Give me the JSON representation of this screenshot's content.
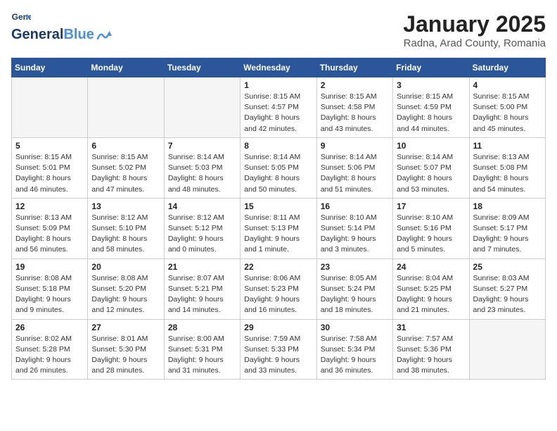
{
  "logo": {
    "text_general": "General",
    "text_blue": "Blue",
    "icon_color": "#4a90d9"
  },
  "header": {
    "month": "January 2025",
    "location": "Radna, Arad County, Romania"
  },
  "weekdays": [
    "Sunday",
    "Monday",
    "Tuesday",
    "Wednesday",
    "Thursday",
    "Friday",
    "Saturday"
  ],
  "weeks": [
    [
      {
        "day": "",
        "empty": true
      },
      {
        "day": "",
        "empty": true
      },
      {
        "day": "",
        "empty": true
      },
      {
        "day": "1",
        "sunrise": "8:15 AM",
        "sunset": "4:57 PM",
        "daylight": "8 hours and 42 minutes."
      },
      {
        "day": "2",
        "sunrise": "8:15 AM",
        "sunset": "4:58 PM",
        "daylight": "8 hours and 43 minutes."
      },
      {
        "day": "3",
        "sunrise": "8:15 AM",
        "sunset": "4:59 PM",
        "daylight": "8 hours and 44 minutes."
      },
      {
        "day": "4",
        "sunrise": "8:15 AM",
        "sunset": "5:00 PM",
        "daylight": "8 hours and 45 minutes."
      }
    ],
    [
      {
        "day": "5",
        "sunrise": "8:15 AM",
        "sunset": "5:01 PM",
        "daylight": "8 hours and 46 minutes."
      },
      {
        "day": "6",
        "sunrise": "8:15 AM",
        "sunset": "5:02 PM",
        "daylight": "8 hours and 47 minutes."
      },
      {
        "day": "7",
        "sunrise": "8:14 AM",
        "sunset": "5:03 PM",
        "daylight": "8 hours and 48 minutes."
      },
      {
        "day": "8",
        "sunrise": "8:14 AM",
        "sunset": "5:05 PM",
        "daylight": "8 hours and 50 minutes."
      },
      {
        "day": "9",
        "sunrise": "8:14 AM",
        "sunset": "5:06 PM",
        "daylight": "8 hours and 51 minutes."
      },
      {
        "day": "10",
        "sunrise": "8:14 AM",
        "sunset": "5:07 PM",
        "daylight": "8 hours and 53 minutes."
      },
      {
        "day": "11",
        "sunrise": "8:13 AM",
        "sunset": "5:08 PM",
        "daylight": "8 hours and 54 minutes."
      }
    ],
    [
      {
        "day": "12",
        "sunrise": "8:13 AM",
        "sunset": "5:09 PM",
        "daylight": "8 hours and 56 minutes."
      },
      {
        "day": "13",
        "sunrise": "8:12 AM",
        "sunset": "5:10 PM",
        "daylight": "8 hours and 58 minutes."
      },
      {
        "day": "14",
        "sunrise": "8:12 AM",
        "sunset": "5:12 PM",
        "daylight": "9 hours and 0 minutes."
      },
      {
        "day": "15",
        "sunrise": "8:11 AM",
        "sunset": "5:13 PM",
        "daylight": "9 hours and 1 minute."
      },
      {
        "day": "16",
        "sunrise": "8:10 AM",
        "sunset": "5:14 PM",
        "daylight": "9 hours and 3 minutes."
      },
      {
        "day": "17",
        "sunrise": "8:10 AM",
        "sunset": "5:16 PM",
        "daylight": "9 hours and 5 minutes."
      },
      {
        "day": "18",
        "sunrise": "8:09 AM",
        "sunset": "5:17 PM",
        "daylight": "9 hours and 7 minutes."
      }
    ],
    [
      {
        "day": "19",
        "sunrise": "8:08 AM",
        "sunset": "5:18 PM",
        "daylight": "9 hours and 9 minutes."
      },
      {
        "day": "20",
        "sunrise": "8:08 AM",
        "sunset": "5:20 PM",
        "daylight": "9 hours and 12 minutes."
      },
      {
        "day": "21",
        "sunrise": "8:07 AM",
        "sunset": "5:21 PM",
        "daylight": "9 hours and 14 minutes."
      },
      {
        "day": "22",
        "sunrise": "8:06 AM",
        "sunset": "5:23 PM",
        "daylight": "9 hours and 16 minutes."
      },
      {
        "day": "23",
        "sunrise": "8:05 AM",
        "sunset": "5:24 PM",
        "daylight": "9 hours and 18 minutes."
      },
      {
        "day": "24",
        "sunrise": "8:04 AM",
        "sunset": "5:25 PM",
        "daylight": "9 hours and 21 minutes."
      },
      {
        "day": "25",
        "sunrise": "8:03 AM",
        "sunset": "5:27 PM",
        "daylight": "9 hours and 23 minutes."
      }
    ],
    [
      {
        "day": "26",
        "sunrise": "8:02 AM",
        "sunset": "5:28 PM",
        "daylight": "9 hours and 26 minutes."
      },
      {
        "day": "27",
        "sunrise": "8:01 AM",
        "sunset": "5:30 PM",
        "daylight": "9 hours and 28 minutes."
      },
      {
        "day": "28",
        "sunrise": "8:00 AM",
        "sunset": "5:31 PM",
        "daylight": "9 hours and 31 minutes."
      },
      {
        "day": "29",
        "sunrise": "7:59 AM",
        "sunset": "5:33 PM",
        "daylight": "9 hours and 33 minutes."
      },
      {
        "day": "30",
        "sunrise": "7:58 AM",
        "sunset": "5:34 PM",
        "daylight": "9 hours and 36 minutes."
      },
      {
        "day": "31",
        "sunrise": "7:57 AM",
        "sunset": "5:36 PM",
        "daylight": "9 hours and 38 minutes."
      },
      {
        "day": "",
        "empty": true
      }
    ]
  ]
}
